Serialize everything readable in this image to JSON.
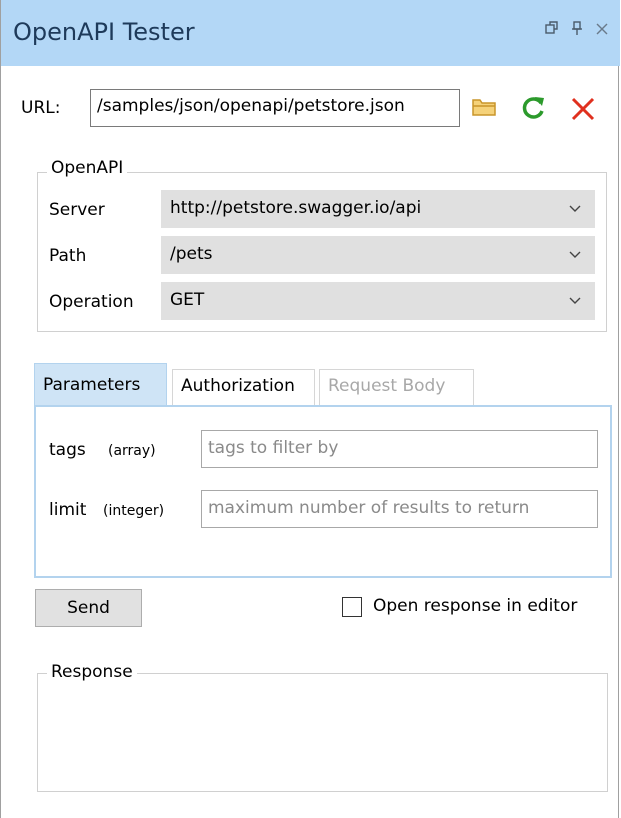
{
  "window": {
    "title": "OpenAPI Tester",
    "icons": [
      "restore-icon",
      "pin-icon",
      "close-icon"
    ]
  },
  "url": {
    "label": "URL:",
    "value": "/samples/json/openapi/petstore.json",
    "icons": [
      "folder-icon",
      "refresh-icon",
      "clear-icon"
    ]
  },
  "openapi": {
    "legend": "OpenAPI",
    "server": {
      "label": "Server",
      "value": "http://petstore.swagger.io/api"
    },
    "path": {
      "label": "Path",
      "value": "/pets"
    },
    "operation": {
      "label": "Operation",
      "value": "GET"
    }
  },
  "tabs": [
    {
      "label": "Parameters",
      "state": "active"
    },
    {
      "label": "Authorization",
      "state": "normal"
    },
    {
      "label": "Request Body",
      "state": "disabled"
    }
  ],
  "parameters": [
    {
      "name": "tags",
      "type": "(array)",
      "placeholder": "tags to filter by"
    },
    {
      "name": "limit",
      "type": "(integer)",
      "placeholder": "maximum number of results to return"
    }
  ],
  "actions": {
    "send_label": "Send",
    "open_in_editor_label": "Open response in editor",
    "open_in_editor_checked": false
  },
  "response": {
    "legend": "Response"
  },
  "colors": {
    "titlebar": "#b3d7f6",
    "folder": "#e8b84a",
    "refresh": "#2c9a2c",
    "clear": "#e0301e"
  }
}
